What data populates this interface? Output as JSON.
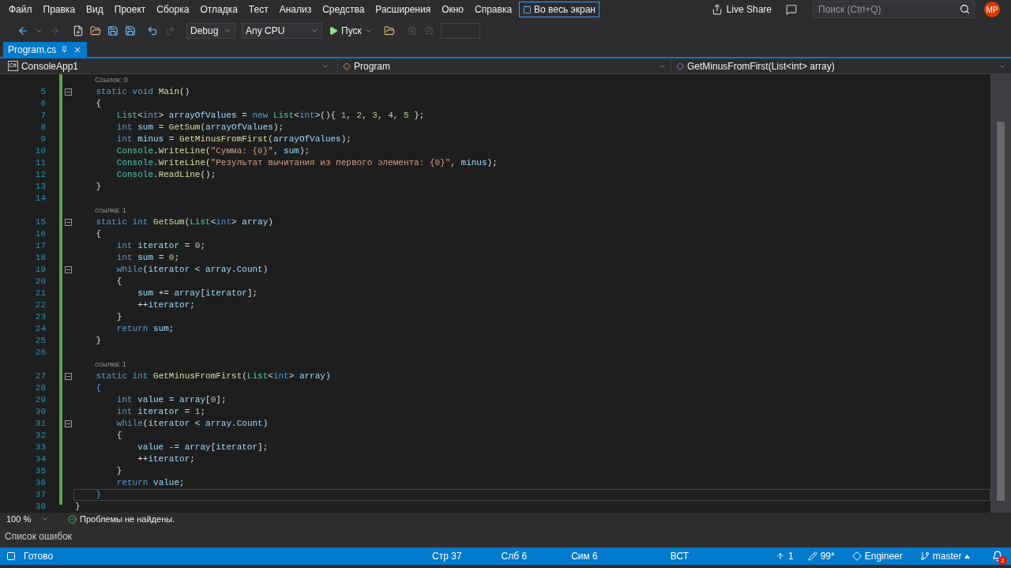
{
  "menu": [
    "Файл",
    "Правка",
    "Вид",
    "Проект",
    "Сборка",
    "Отладка",
    "Тест",
    "Анализ",
    "Средства",
    "Расширения",
    "Окно",
    "Справка"
  ],
  "fullscreen_button": "Во весь экран",
  "live_share": "Live Share",
  "search": {
    "placeholder": "Поиск (Ctrl+Q)"
  },
  "avatar": "MP",
  "toolbar": {
    "configuration": "Debug",
    "platform": "Any CPU",
    "start": "Пуск"
  },
  "tabs": [
    {
      "label": "Program.cs",
      "selected": true
    }
  ],
  "nav_bar": {
    "project_icon": "C#",
    "project": "ConsoleApp1",
    "class": "Program",
    "member": "GetMinusFromFirst(List<int> array)"
  },
  "code_lines": [
    {
      "kind": "lens",
      "text": "Ссылок: 0"
    },
    {
      "kind": "code",
      "number": "5",
      "fold": true,
      "current": false,
      "tokens": [
        {
          "kind": "kw",
          "text": "    static void "
        },
        {
          "kind": "m",
          "text": "Main"
        },
        {
          "kind": "t",
          "text": "()"
        }
      ]
    },
    {
      "kind": "code",
      "number": "6",
      "fold": false,
      "current": false,
      "tokens": [
        {
          "kind": "t",
          "text": "    {"
        }
      ]
    },
    {
      "kind": "code",
      "number": "7",
      "fold": false,
      "current": false,
      "tokens": [
        {
          "kind": "ty",
          "text": "        List"
        },
        {
          "kind": "t",
          "text": "<"
        },
        {
          "kind": "kw",
          "text": "int"
        },
        {
          "kind": "t",
          "text": "> "
        },
        {
          "kind": "v",
          "text": "arrayOfValues"
        },
        {
          "kind": "t",
          "text": " = "
        },
        {
          "kind": "kw",
          "text": "new "
        },
        {
          "kind": "ty",
          "text": "List"
        },
        {
          "kind": "t",
          "text": "<"
        },
        {
          "kind": "kw",
          "text": "int"
        },
        {
          "kind": "t",
          "text": ">(){ "
        },
        {
          "kind": "n",
          "text": "1"
        },
        {
          "kind": "t",
          "text": ", "
        },
        {
          "kind": "n",
          "text": "2"
        },
        {
          "kind": "t",
          "text": ", "
        },
        {
          "kind": "n",
          "text": "3"
        },
        {
          "kind": "t",
          "text": ", "
        },
        {
          "kind": "n",
          "text": "4"
        },
        {
          "kind": "t",
          "text": ", "
        },
        {
          "kind": "n",
          "text": "5"
        },
        {
          "kind": "t",
          "text": " };"
        }
      ]
    },
    {
      "kind": "code",
      "number": "8",
      "fold": false,
      "current": false,
      "tokens": [
        {
          "kind": "kw",
          "text": "        int "
        },
        {
          "kind": "v",
          "text": "sum"
        },
        {
          "kind": "t",
          "text": " = "
        },
        {
          "kind": "m",
          "text": "GetSum"
        },
        {
          "kind": "t",
          "text": "("
        },
        {
          "kind": "v",
          "text": "arrayOfValues"
        },
        {
          "kind": "t",
          "text": ");"
        }
      ]
    },
    {
      "kind": "code",
      "number": "9",
      "fold": false,
      "current": false,
      "tokens": [
        {
          "kind": "kw",
          "text": "        int "
        },
        {
          "kind": "v",
          "text": "minus"
        },
        {
          "kind": "t",
          "text": " = "
        },
        {
          "kind": "m",
          "text": "GetMinusFromFirst"
        },
        {
          "kind": "t",
          "text": "("
        },
        {
          "kind": "v",
          "text": "arrayOfValues"
        },
        {
          "kind": "t",
          "text": ");"
        }
      ]
    },
    {
      "kind": "code",
      "number": "10",
      "fold": false,
      "current": false,
      "tokens": [
        {
          "kind": "ty",
          "text": "        Console"
        },
        {
          "kind": "t",
          "text": "."
        },
        {
          "kind": "m",
          "text": "WriteLine"
        },
        {
          "kind": "t",
          "text": "("
        },
        {
          "kind": "s",
          "text": "\"Сумма: {0}\""
        },
        {
          "kind": "t",
          "text": ", "
        },
        {
          "kind": "v",
          "text": "sum"
        },
        {
          "kind": "t",
          "text": ");"
        }
      ]
    },
    {
      "kind": "code",
      "number": "11",
      "fold": false,
      "current": false,
      "tokens": [
        {
          "kind": "ty",
          "text": "        Console"
        },
        {
          "kind": "t",
          "text": "."
        },
        {
          "kind": "m",
          "text": "WriteLine"
        },
        {
          "kind": "t",
          "text": "("
        },
        {
          "kind": "s",
          "text": "\"Результат вычитания из первого элемента: {0}\""
        },
        {
          "kind": "t",
          "text": ", "
        },
        {
          "kind": "v",
          "text": "minus"
        },
        {
          "kind": "t",
          "text": ");"
        }
      ]
    },
    {
      "kind": "code",
      "number": "12",
      "fold": false,
      "current": false,
      "tokens": [
        {
          "kind": "ty",
          "text": "        Console"
        },
        {
          "kind": "t",
          "text": "."
        },
        {
          "kind": "m",
          "text": "ReadLine"
        },
        {
          "kind": "t",
          "text": "();"
        }
      ]
    },
    {
      "kind": "code",
      "number": "13",
      "fold": false,
      "current": false,
      "tokens": [
        {
          "kind": "t",
          "text": "    }"
        }
      ]
    },
    {
      "kind": "code",
      "number": "14",
      "fold": false,
      "current": false
    },
    {
      "kind": "lens",
      "text": "ссылка: 1"
    },
    {
      "kind": "code",
      "number": "15",
      "fold": true,
      "current": false,
      "tokens": [
        {
          "kind": "kw",
          "text": "    static int "
        },
        {
          "kind": "m",
          "text": "GetSum"
        },
        {
          "kind": "t",
          "text": "("
        },
        {
          "kind": "ty",
          "text": "List"
        },
        {
          "kind": "t",
          "text": "<"
        },
        {
          "kind": "kw",
          "text": "int"
        },
        {
          "kind": "t",
          "text": "> "
        },
        {
          "kind": "v",
          "text": "array"
        },
        {
          "kind": "t",
          "text": ")"
        }
      ]
    },
    {
      "kind": "code",
      "number": "16",
      "fold": false,
      "current": false,
      "tokens": [
        {
          "kind": "t",
          "text": "    {"
        }
      ]
    },
    {
      "kind": "code",
      "number": "17",
      "fold": false,
      "current": false,
      "tokens": [
        {
          "kind": "kw",
          "text": "        int "
        },
        {
          "kind": "v",
          "text": "iterator"
        },
        {
          "kind": "t",
          "text": " = "
        },
        {
          "kind": "n",
          "text": "0"
        },
        {
          "kind": "t",
          "text": ";"
        }
      ]
    },
    {
      "kind": "code",
      "number": "18",
      "fold": false,
      "current": false,
      "tokens": [
        {
          "kind": "kw",
          "text": "        int "
        },
        {
          "kind": "v",
          "text": "sum"
        },
        {
          "kind": "t",
          "text": " = "
        },
        {
          "kind": "n",
          "text": "0"
        },
        {
          "kind": "t",
          "text": ";"
        }
      ]
    },
    {
      "kind": "code",
      "number": "19",
      "fold": true,
      "current": false,
      "tokens": [
        {
          "kind": "kw",
          "text": "        while"
        },
        {
          "kind": "t",
          "text": "("
        },
        {
          "kind": "v",
          "text": "iterator"
        },
        {
          "kind": "t",
          "text": " < "
        },
        {
          "kind": "v",
          "text": "array"
        },
        {
          "kind": "t",
          "text": "."
        },
        {
          "kind": "v",
          "text": "Count"
        },
        {
          "kind": "t",
          "text": ")"
        }
      ]
    },
    {
      "kind": "code",
      "number": "20",
      "fold": false,
      "current": false,
      "tokens": [
        {
          "kind": "t",
          "text": "        {"
        }
      ]
    },
    {
      "kind": "code",
      "number": "21",
      "fold": false,
      "current": false,
      "tokens": [
        {
          "kind": "v",
          "text": "            sum"
        },
        {
          "kind": "t",
          "text": " += "
        },
        {
          "kind": "v",
          "text": "array"
        },
        {
          "kind": "t",
          "text": "["
        },
        {
          "kind": "v",
          "text": "iterator"
        },
        {
          "kind": "t",
          "text": "];"
        }
      ]
    },
    {
      "kind": "code",
      "number": "22",
      "fold": false,
      "current": false,
      "tokens": [
        {
          "kind": "t",
          "text": "            ++"
        },
        {
          "kind": "v",
          "text": "iterator"
        },
        {
          "kind": "t",
          "text": ";"
        }
      ]
    },
    {
      "kind": "code",
      "number": "23",
      "fold": false,
      "current": false,
      "tokens": [
        {
          "kind": "t",
          "text": "        }"
        }
      ]
    },
    {
      "kind": "code",
      "number": "24",
      "fold": false,
      "current": false,
      "tokens": [
        {
          "kind": "kw",
          "text": "        return "
        },
        {
          "kind": "v",
          "text": "sum"
        },
        {
          "kind": "t",
          "text": ";"
        }
      ]
    },
    {
      "kind": "code",
      "number": "25",
      "fold": false,
      "current": false,
      "tokens": [
        {
          "kind": "t",
          "text": "    }"
        }
      ]
    },
    {
      "kind": "code",
      "number": "26",
      "fold": false,
      "current": false
    },
    {
      "kind": "lens",
      "text": "ссылка: 1"
    },
    {
      "kind": "code",
      "number": "27",
      "fold": true,
      "current": false,
      "tokens": [
        {
          "kind": "kw",
          "text": "    static int "
        },
        {
          "kind": "m",
          "text": "GetMinusFromFirst"
        },
        {
          "kind": "t",
          "text": "("
        },
        {
          "kind": "ty",
          "text": "List"
        },
        {
          "kind": "t",
          "text": "<"
        },
        {
          "kind": "kw",
          "text": "int"
        },
        {
          "kind": "t",
          "text": "> "
        },
        {
          "kind": "v",
          "text": "array"
        },
        {
          "kind": "t",
          "text": ")"
        }
      ]
    },
    {
      "kind": "code",
      "number": "28",
      "fold": false,
      "current": false,
      "tokens": [
        {
          "kind": "kw",
          "text": "    {"
        }
      ]
    },
    {
      "kind": "code",
      "number": "29",
      "fold": false,
      "current": false,
      "tokens": [
        {
          "kind": "kw",
          "text": "        int "
        },
        {
          "kind": "v",
          "text": "value"
        },
        {
          "kind": "t",
          "text": " = "
        },
        {
          "kind": "v",
          "text": "array"
        },
        {
          "kind": "t",
          "text": "["
        },
        {
          "kind": "n",
          "text": "0"
        },
        {
          "kind": "t",
          "text": "];"
        }
      ]
    },
    {
      "kind": "code",
      "number": "30",
      "fold": false,
      "current": false,
      "tokens": [
        {
          "kind": "kw",
          "text": "        int "
        },
        {
          "kind": "v",
          "text": "iterator"
        },
        {
          "kind": "t",
          "text": " = "
        },
        {
          "kind": "n",
          "text": "1"
        },
        {
          "kind": "t",
          "text": ";"
        }
      ]
    },
    {
      "kind": "code",
      "number": "31",
      "fold": true,
      "current": false,
      "tokens": [
        {
          "kind": "kw",
          "text": "        while"
        },
        {
          "kind": "t",
          "text": "("
        },
        {
          "kind": "v",
          "text": "iterator"
        },
        {
          "kind": "t",
          "text": " < "
        },
        {
          "kind": "v",
          "text": "array"
        },
        {
          "kind": "t",
          "text": "."
        },
        {
          "kind": "v",
          "text": "Count"
        },
        {
          "kind": "t",
          "text": ")"
        }
      ]
    },
    {
      "kind": "code",
      "number": "32",
      "fold": false,
      "current": false,
      "tokens": [
        {
          "kind": "t",
          "text": "        {"
        }
      ]
    },
    {
      "kind": "code",
      "number": "33",
      "fold": false,
      "current": false,
      "tokens": [
        {
          "kind": "v",
          "text": "            value"
        },
        {
          "kind": "t",
          "text": " -= "
        },
        {
          "kind": "v",
          "text": "array"
        },
        {
          "kind": "t",
          "text": "["
        },
        {
          "kind": "v",
          "text": "iterator"
        },
        {
          "kind": "t",
          "text": "];"
        }
      ]
    },
    {
      "kind": "code",
      "number": "34",
      "fold": false,
      "current": false,
      "tokens": [
        {
          "kind": "t",
          "text": "            ++"
        },
        {
          "kind": "v",
          "text": "iterator"
        },
        {
          "kind": "t",
          "text": ";"
        }
      ]
    },
    {
      "kind": "code",
      "number": "35",
      "fold": false,
      "current": false,
      "tokens": [
        {
          "kind": "t",
          "text": "        }"
        }
      ]
    },
    {
      "kind": "code",
      "number": "36",
      "fold": false,
      "current": false,
      "tokens": [
        {
          "kind": "kw",
          "text": "        return "
        },
        {
          "kind": "v",
          "text": "value"
        },
        {
          "kind": "t",
          "text": ";"
        }
      ]
    },
    {
      "kind": "code",
      "number": "37",
      "fold": false,
      "current": true,
      "tokens": [
        {
          "kind": "kw",
          "text": "    }"
        }
      ]
    },
    {
      "kind": "code",
      "number": "38",
      "fold": false,
      "current": false,
      "tokens": [
        {
          "kind": "t",
          "text": "}"
        }
      ]
    }
  ],
  "editor_footer": {
    "zoom": "100 %",
    "issues": "Проблемы не найдены."
  },
  "panel_title": "Список ошибок",
  "status_bar": {
    "state": "Готово",
    "line": "Стр 37",
    "column": "Слб 6",
    "char": "Сим 6",
    "mode": "ВСТ",
    "push": "1",
    "changes": "99*",
    "repo": "Engineer",
    "branch": "master",
    "notifications": "2"
  }
}
